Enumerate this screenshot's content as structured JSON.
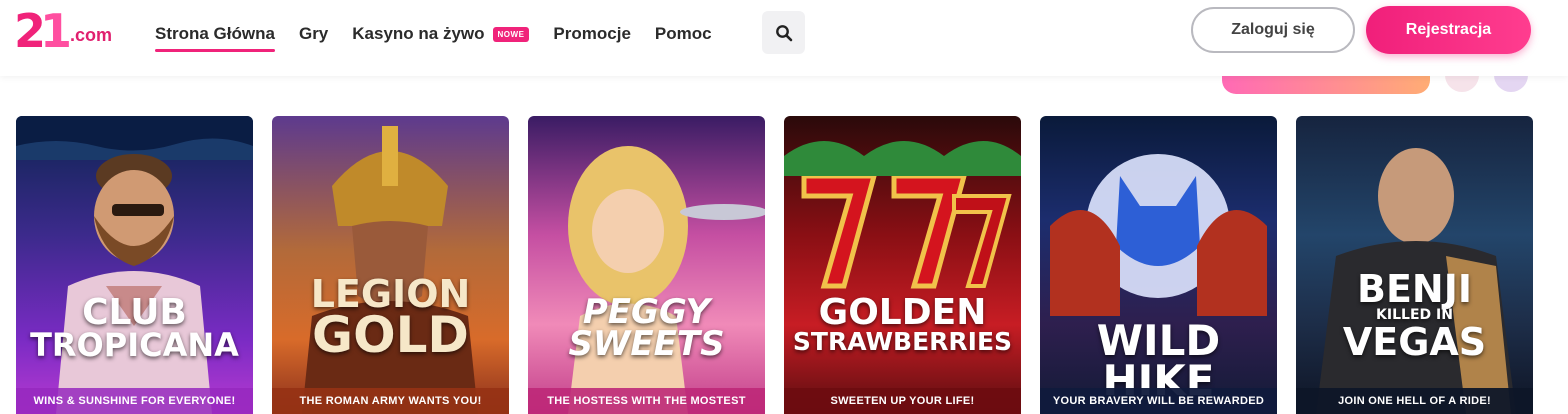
{
  "brand": {
    "logo_number": "21",
    "logo_domain": ".com",
    "pink": "#f0237a"
  },
  "nav": {
    "items": [
      {
        "label": "Strona Główna",
        "active": true
      },
      {
        "label": "Gry"
      },
      {
        "label": "Kasyno na żywo",
        "badge": "NOWE"
      },
      {
        "label": "Promocje"
      },
      {
        "label": "Pomoc"
      }
    ],
    "search_icon": "search-icon"
  },
  "auth": {
    "login_label": "Zaloguj się",
    "register_label": "Rejestracja"
  },
  "games": [
    {
      "title_lines": [
        "CLUB",
        "TROPICANA"
      ],
      "tagline": "WINS & SUNSHINE FOR EVERYONE!"
    },
    {
      "title_lines": [
        "LEGION",
        "GOLD"
      ],
      "tagline": "THE ROMAN ARMY WANTS YOU!"
    },
    {
      "title_lines": [
        "PEGGY",
        "SWEETS"
      ],
      "tagline": "THE HOSTESS WITH THE MOSTEST"
    },
    {
      "title_lines": [
        "GOLDEN",
        "STRAWBERRIES"
      ],
      "tagline": "SWEETEN UP YOUR LIFE!"
    },
    {
      "title_lines": [
        "WILD HIKE"
      ],
      "tagline": "YOUR BRAVERY WILL BE REWARDED"
    },
    {
      "title_lines": [
        "BENJI",
        "KILLED IN",
        "VEGAS"
      ],
      "tagline": "JOIN ONE HELL OF A RIDE!"
    }
  ]
}
